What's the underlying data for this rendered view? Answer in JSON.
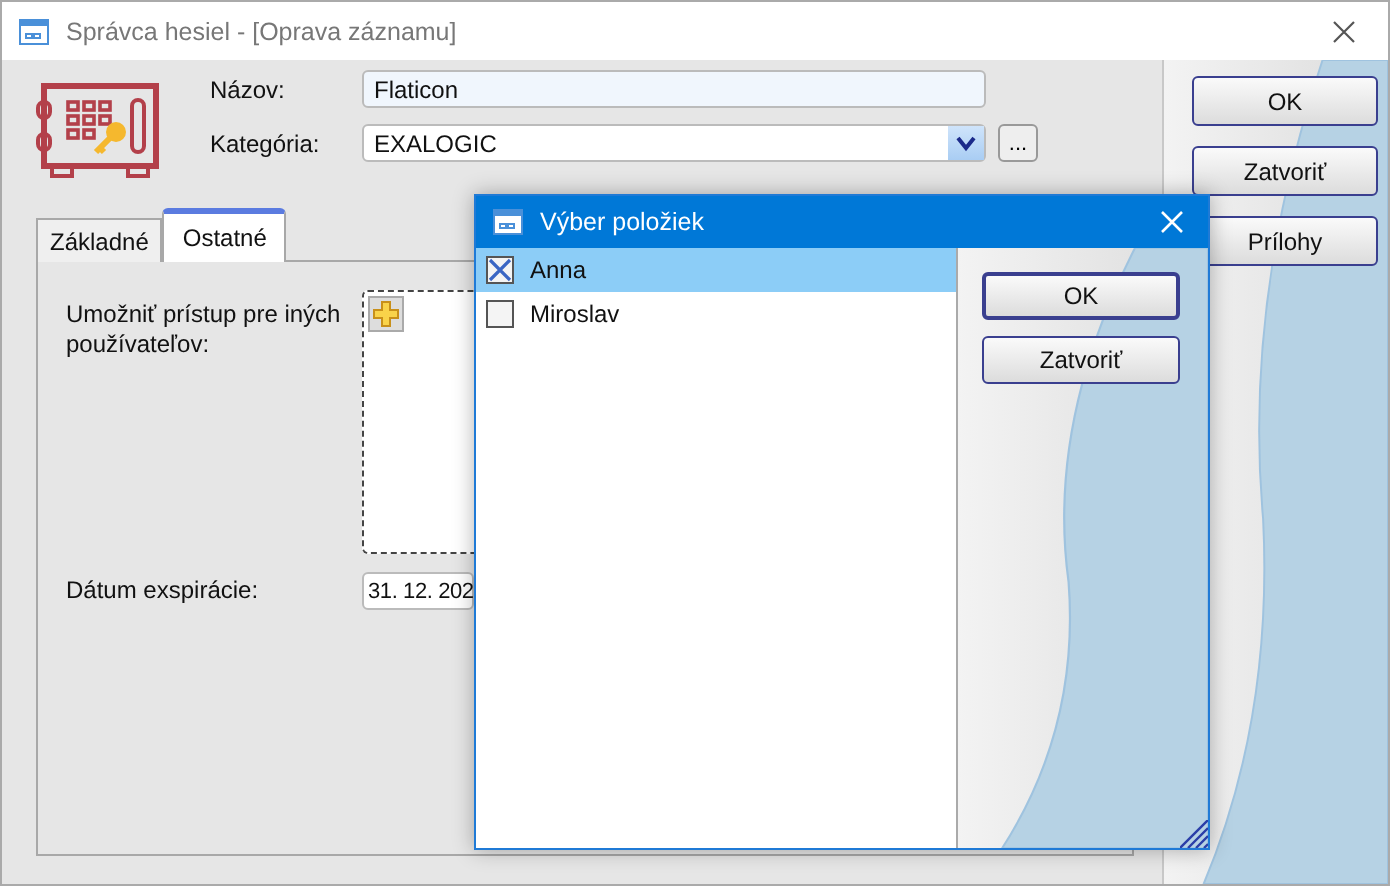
{
  "window": {
    "title": "Správca hesiel - [Oprava záznamu]"
  },
  "fields": [
    {
      "label": "Názov:",
      "value": "Flaticon",
      "kind": "text"
    },
    {
      "label": "Kategória:",
      "value": "EXALOGIC",
      "kind": "select"
    }
  ],
  "more_button": "...",
  "tabs": [
    {
      "label": "Základné",
      "selected": false
    },
    {
      "label": "Ostatné",
      "selected": true
    }
  ],
  "access": {
    "label": "Umožniť prístup pre iných používateľov:"
  },
  "expiry": {
    "label": "Dátum exspirácie:",
    "value": "31. 12. 202"
  },
  "buttons": [
    "OK",
    "Zatvoriť",
    "Prílohy"
  ],
  "dialog": {
    "title": "Výber položiek",
    "items": [
      {
        "label": "Anna",
        "checked": true,
        "selected": true
      },
      {
        "label": "Miroslav",
        "checked": false,
        "selected": false
      }
    ],
    "buttons": [
      "OK",
      "Zatvoriť"
    ]
  }
}
